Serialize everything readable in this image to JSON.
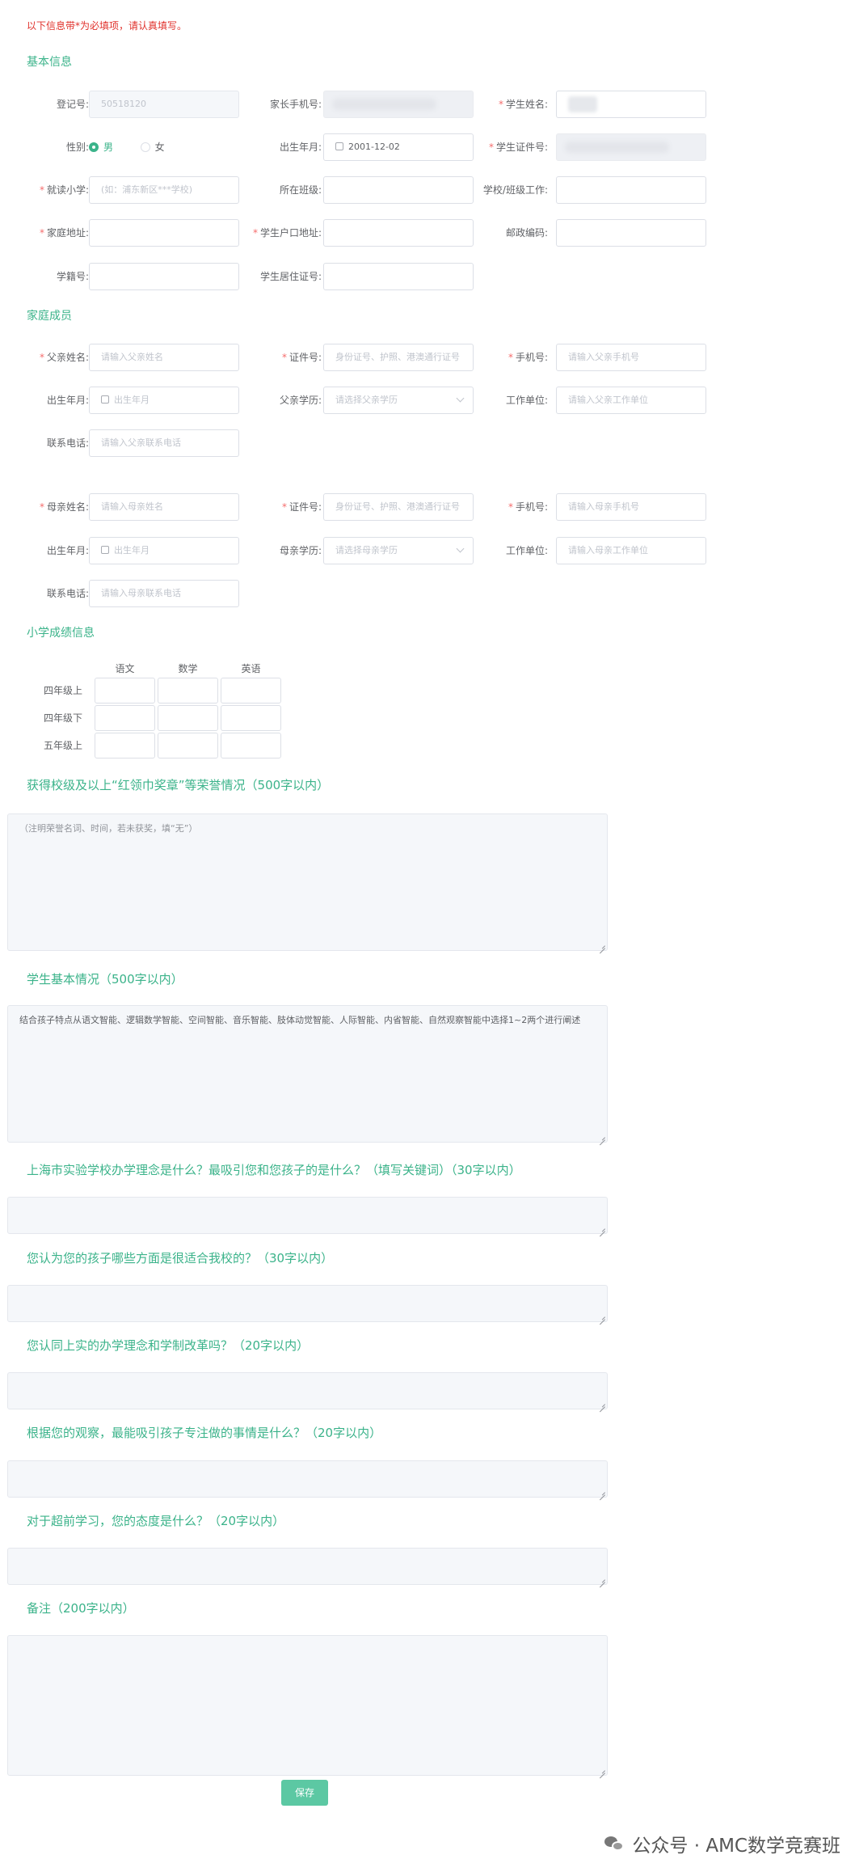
{
  "notice": "以下信息带*为必填项，请认真填写。",
  "sections": {
    "basic": "基本信息",
    "family": "家庭成员",
    "grades": "小学成绩信息",
    "honors": "获得校级及以上“红领巾奖章”等荣誉情况（500字以内）",
    "student_basic": "学生基本情况（500字以内）",
    "q1": "上海市实验学校办学理念是什么？最吸引您和您孩子的是什么？（填写关键词）（30字以内）",
    "q2": "您认为您的孩子哪些方面是很适合我校的？（30字以内）",
    "q3": "您认同上实的办学理念和学制改革吗？（20字以内）",
    "q4": "根据您的观察，最能吸引孩子专注做的事情是什么？（20字以内）",
    "q5": "对于超前学习，您的态度是什么？（20字以内）",
    "remarks": "备注（200字以内）"
  },
  "basic": {
    "reg_no": {
      "label": "登记号:",
      "value": "50518120"
    },
    "parent_phone": {
      "label": "家长手机号:"
    },
    "student_name": {
      "label": "学生姓名:"
    },
    "gender": {
      "label": "性别:",
      "male": "男",
      "female": "女",
      "selected": "男"
    },
    "birth": {
      "label": "出生年月:",
      "value": "2001-12-02"
    },
    "student_id": {
      "label": "学生证件号:"
    },
    "school": {
      "label": "就读小学:",
      "placeholder": "(如：浦东新区***学校)"
    },
    "class": {
      "label": "所在班级:"
    },
    "school_job": {
      "label": "学校/班级工作:"
    },
    "address": {
      "label": "家庭地址:"
    },
    "hukou": {
      "label": "学生户口地址:"
    },
    "postcode": {
      "label": "邮政编码:"
    },
    "student_no": {
      "label": "学籍号:"
    },
    "residence": {
      "label": "学生居住证号:"
    }
  },
  "father": {
    "name": {
      "label": "父亲姓名:",
      "placeholder": "请输入父亲姓名"
    },
    "id": {
      "label": "证件号:",
      "placeholder": "身份证号、护照、港澳通行证号"
    },
    "phone": {
      "label": "手机号:",
      "placeholder": "请输入父亲手机号"
    },
    "birth": {
      "label": "出生年月:",
      "placeholder": "出生年月"
    },
    "edu": {
      "label": "父亲学历:",
      "placeholder": "请选择父亲学历"
    },
    "work": {
      "label": "工作单位:",
      "placeholder": "请输入父亲工作单位"
    },
    "contact": {
      "label": "联系电话:",
      "placeholder": "请输入父亲联系电话"
    }
  },
  "mother": {
    "name": {
      "label": "母亲姓名:",
      "placeholder": "请输入母亲姓名"
    },
    "id": {
      "label": "证件号:",
      "placeholder": "身份证号、护照、港澳通行证号"
    },
    "phone": {
      "label": "手机号:",
      "placeholder": "请输入母亲手机号"
    },
    "birth": {
      "label": "出生年月:",
      "placeholder": "出生年月"
    },
    "edu": {
      "label": "母亲学历:",
      "placeholder": "请选择母亲学历"
    },
    "work": {
      "label": "工作单位:",
      "placeholder": "请输入母亲工作单位"
    },
    "contact": {
      "label": "联系电话:",
      "placeholder": "请输入母亲联系电话"
    }
  },
  "grades": {
    "subjects": [
      "语文",
      "数学",
      "英语"
    ],
    "rows": [
      "四年级上",
      "四年级下",
      "五年级上"
    ]
  },
  "textareas": {
    "honors_placeholder": "（注明荣誉名词、时间，若未获奖，填“无”）",
    "student_basic_text": "结合孩子特点从语文智能、逻辑数学智能、空间智能、音乐智能、肢体动觉智能、人际智能、内省智能、自然观察智能中选择1~2两个进行阐述"
  },
  "save_label": "保存",
  "watermark": "公众号 · AMC数学竞赛班",
  "colors": {
    "accent": "#3bb38a",
    "required": "#f56c6c",
    "notice": "#e0312b"
  }
}
